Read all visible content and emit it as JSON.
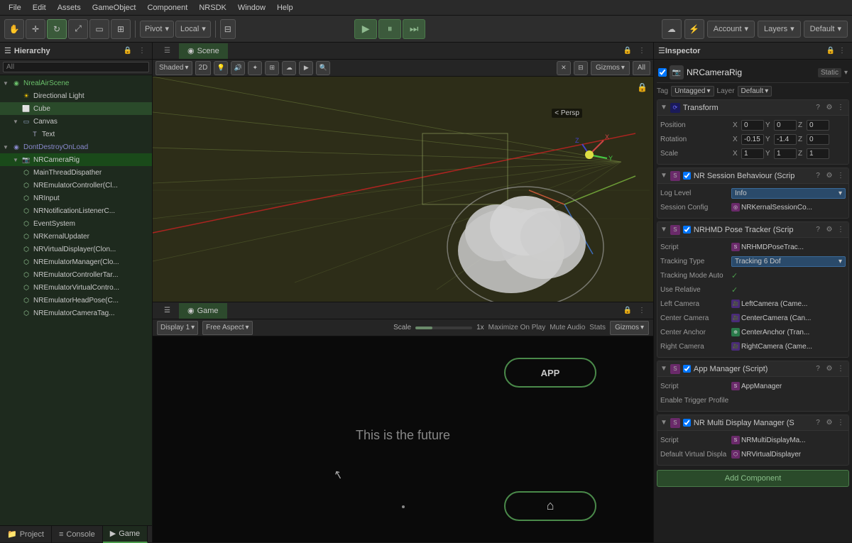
{
  "menubar": {
    "items": [
      "File",
      "Edit",
      "Assets",
      "GameObject",
      "Component",
      "NRSDK",
      "Window",
      "Help"
    ]
  },
  "toolbar": {
    "tools": [
      "hand",
      "move",
      "rotate",
      "scale",
      "rect",
      "transform"
    ],
    "pivot_label": "Pivot",
    "local_label": "Local",
    "account_label": "Account",
    "layers_label": "Layers",
    "default_label": "Default"
  },
  "hierarchy": {
    "title": "Hierarchy",
    "search_placeholder": "All",
    "items": [
      {
        "label": "NrealAirScene",
        "depth": 0,
        "type": "scene",
        "arrow": "▼",
        "is_scene": true
      },
      {
        "label": "Directional Light",
        "depth": 1,
        "arrow": "",
        "type": "light"
      },
      {
        "label": "Cube",
        "depth": 1,
        "arrow": "",
        "type": "cube",
        "highlighted": true
      },
      {
        "label": "Canvas",
        "depth": 1,
        "arrow": "▼",
        "type": "canvas"
      },
      {
        "label": "Text",
        "depth": 2,
        "arrow": "",
        "type": "text"
      },
      {
        "label": "DontDestroyOnLoad",
        "depth": 0,
        "arrow": "▼",
        "type": "dontdestroy",
        "is_dontdestroy": true
      },
      {
        "label": "NRCameraRig",
        "depth": 1,
        "arrow": "▼",
        "type": "camera",
        "selected": true
      },
      {
        "label": "MainThreadDispatcher",
        "depth": 1,
        "arrow": "",
        "type": "script"
      },
      {
        "label": "NREmulatorController(Cl...",
        "depth": 1,
        "arrow": "",
        "type": "script"
      },
      {
        "label": "NRInput",
        "depth": 1,
        "arrow": "",
        "type": "script"
      },
      {
        "label": "NRNotificationListenerC...",
        "depth": 1,
        "arrow": "",
        "type": "script"
      },
      {
        "label": "EventSystem",
        "depth": 1,
        "arrow": "",
        "type": "script"
      },
      {
        "label": "NRKernalUpdater",
        "depth": 1,
        "arrow": "",
        "type": "script"
      },
      {
        "label": "NRVirtualDisplayer(Clon...",
        "depth": 1,
        "arrow": "",
        "type": "script"
      },
      {
        "label": "NREmulatorManager(Clo...",
        "depth": 1,
        "arrow": "",
        "type": "script"
      },
      {
        "label": "NREmulatorControllerTar...",
        "depth": 1,
        "arrow": "",
        "type": "script"
      },
      {
        "label": "NREmulatorVirtualContro...",
        "depth": 1,
        "arrow": "",
        "type": "script"
      },
      {
        "label": "NREmulatorHeadPose(C...",
        "depth": 1,
        "arrow": "",
        "type": "script"
      },
      {
        "label": "NREmulatorCameraTag...",
        "depth": 1,
        "arrow": "",
        "type": "script"
      }
    ]
  },
  "bottom_tabs": [
    {
      "label": "Project",
      "icon": "📁"
    },
    {
      "label": "Console",
      "icon": "≡"
    },
    {
      "label": "Game",
      "icon": "▶"
    }
  ],
  "scene_view": {
    "title": "Scene",
    "shading": "Shaded",
    "mode_2d": "2D",
    "persp_label": "< Persp"
  },
  "game_view": {
    "title": "Game",
    "display": "Display 1",
    "aspect": "Free Aspect",
    "scale_label": "Scale",
    "scale_value": "1x",
    "maximize_label": "Maximize On Play",
    "mute_label": "Mute Audio",
    "stats_label": "Stats",
    "gizmos_label": "Gizmos",
    "app_button_label": "APP",
    "game_text": "This is the future",
    "home_icon": "⌂"
  },
  "inspector": {
    "title": "Inspector",
    "object_name": "NRCameraRig",
    "static_label": "Static",
    "tag_label": "Tag",
    "tag_value": "Untagged",
    "layer_label": "Layer",
    "layer_value": "Default",
    "components": [
      {
        "name": "Transform",
        "type": "transform",
        "checked": true,
        "fields": [
          {
            "label": "Position",
            "x": "0",
            "y": "0",
            "z": "0"
          },
          {
            "label": "Rotation",
            "x": "-0.15",
            "y": "-1.4",
            "z": "0"
          },
          {
            "label": "Scale",
            "x": "1",
            "y": "1",
            "z": "1"
          }
        ]
      },
      {
        "name": "NR Session Behaviour (Scrip",
        "type": "script",
        "checked": true,
        "fields": [
          {
            "label": "Log Level",
            "value": "Info",
            "type": "dropdown"
          },
          {
            "label": "Session Config",
            "value": "NRKernalSessionCo...",
            "type": "ref"
          }
        ]
      },
      {
        "name": "NRHMD Pose Tracker (Scrip",
        "type": "script",
        "checked": true,
        "fields": [
          {
            "label": "Script",
            "value": "NRHMDPoseTrac...",
            "type": "ref"
          },
          {
            "label": "Tracking Type",
            "value": "Tracking 6 Dof",
            "type": "dropdown"
          },
          {
            "label": "Tracking Mode Auto",
            "value": "✓",
            "type": "toggle"
          },
          {
            "label": "Use Relative",
            "value": "✓",
            "type": "toggle"
          },
          {
            "label": "Left Camera",
            "value": "LeftCamera (Came...",
            "type": "ref"
          },
          {
            "label": "Center Camera",
            "value": "CenterCamera (Car...",
            "type": "ref"
          },
          {
            "label": "Center Anchor",
            "value": "CenterAnchor (Tran...",
            "type": "ref"
          },
          {
            "label": "Right Camera",
            "value": "RightCamera (Came...",
            "type": "ref"
          }
        ]
      },
      {
        "name": "App Manager (Script)",
        "type": "script",
        "checked": true,
        "fields": [
          {
            "label": "Script",
            "value": "AppManager",
            "type": "ref"
          },
          {
            "label": "Enable Trigger Profile",
            "value": "",
            "type": "empty"
          }
        ]
      },
      {
        "name": "NR Multi Display Manager (S",
        "type": "script",
        "checked": true,
        "fields": [
          {
            "label": "Script",
            "value": "NRMultiDisplayMa...",
            "type": "ref"
          },
          {
            "label": "Default Virtual Displa",
            "value": "NRVirtualDisplayer",
            "type": "ref"
          }
        ]
      }
    ],
    "add_component_label": "Add Component"
  }
}
